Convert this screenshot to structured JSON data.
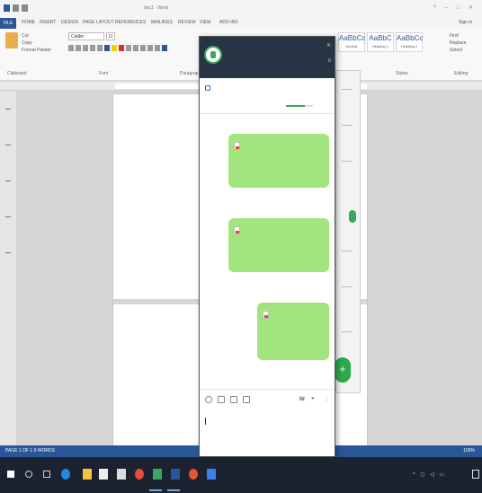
{
  "word": {
    "title": "doc1 - Word",
    "window_controls": "? – □ ✕",
    "file_tab": "FILE",
    "tabs": [
      "HOME",
      "INSERT",
      "DESIGN",
      "PAGE LAYOUT",
      "REFERENCES",
      "MAILINGS",
      "REVIEW",
      "VIEW",
      "ADD-INS"
    ],
    "sign_in": "Sign in",
    "clipboard": {
      "cut": "Cut",
      "copy": "Copy",
      "format_painter": "Format Painter",
      "group": "Clipboard"
    },
    "font_name": "Calibri",
    "font_size": "11",
    "groups": {
      "font": "Font",
      "paragraph": "Paragraph",
      "styles": "Styles",
      "editing": "Editing"
    },
    "styles": [
      {
        "sample": "AaBbCc",
        "name": "Normal"
      },
      {
        "sample": "AaBbC",
        "name": "Heading 1"
      },
      {
        "sample": "AaBbCc",
        "name": "Heading 2"
      }
    ],
    "editing": {
      "find": "Find",
      "replace": "Replace",
      "select": "Select"
    },
    "status_left": "PAGE 1 OF 1   0 WORDS",
    "status_right": "100%"
  },
  "chat": {
    "name": "",
    "subtitle": "",
    "pinned_text": "",
    "messages": [
      {
        "file_name": "",
        "meta_1": "",
        "meta_2": ""
      },
      {
        "file_name": "",
        "meta_1": "",
        "meta_2": ""
      },
      {
        "file_name": "",
        "meta_1": "",
        "meta_2": "",
        "meta_3": ""
      }
    ],
    "fab": "+"
  },
  "taskbar": {
    "apps": [
      "windows-icon",
      "search-icon",
      "task-view-icon",
      "edge-icon",
      "file-explorer-icon",
      "store-icon",
      "mail-icon",
      "chrome-icon",
      "line-icon",
      "word-icon"
    ],
    "clock_time": "",
    "clock_date": ""
  },
  "colors": {
    "word_blue": "#2b579a",
    "chat_header": "#273444",
    "bubble_green": "#a2e57e",
    "accent_green": "#2ea84c",
    "taskbar": "#1b2330"
  }
}
